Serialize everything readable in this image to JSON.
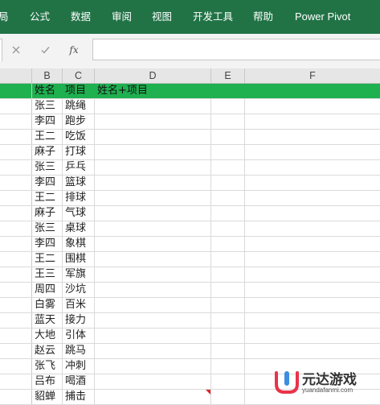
{
  "ribbon": {
    "tabs": [
      "局",
      "公式",
      "数据",
      "审阅",
      "视图",
      "开发工具",
      "帮助",
      "Power Pivot"
    ],
    "bg_color": "#217346"
  },
  "formula_bar": {
    "cancel_icon": "close-icon",
    "enter_icon": "check-icon",
    "fx_label": "fx",
    "value": ""
  },
  "columns": [
    "B",
    "C",
    "D",
    "E",
    "F"
  ],
  "sheet": {
    "header": {
      "b": "姓名",
      "c": "项目",
      "d": "姓名+项目"
    },
    "header_color": "#1fb050",
    "rows": [
      {
        "b": "张三",
        "c": "跳绳"
      },
      {
        "b": "李四",
        "c": "跑步"
      },
      {
        "b": "王二",
        "c": "吃饭"
      },
      {
        "b": "麻子",
        "c": "打球"
      },
      {
        "b": "张三",
        "c": "乒乓"
      },
      {
        "b": "李四",
        "c": "篮球"
      },
      {
        "b": "王二",
        "c": "排球"
      },
      {
        "b": "麻子",
        "c": "气球"
      },
      {
        "b": "张三",
        "c": "桌球"
      },
      {
        "b": "李四",
        "c": "象棋"
      },
      {
        "b": "王二",
        "c": "围棋"
      },
      {
        "b": "王三",
        "c": "军旗"
      },
      {
        "b": "周四",
        "c": "沙坑"
      },
      {
        "b": "白雾",
        "c": "百米"
      },
      {
        "b": "蓝天",
        "c": "接力"
      },
      {
        "b": "大地",
        "c": "引体"
      },
      {
        "b": "赵云",
        "c": "跳马"
      },
      {
        "b": "张飞",
        "c": "冲刺"
      },
      {
        "b": "吕布",
        "c": "喝酒"
      },
      {
        "b": "貂蝉",
        "c": "捕击"
      }
    ]
  },
  "watermark": {
    "name": "元达游戏",
    "url": "yuandafanmi.com"
  }
}
